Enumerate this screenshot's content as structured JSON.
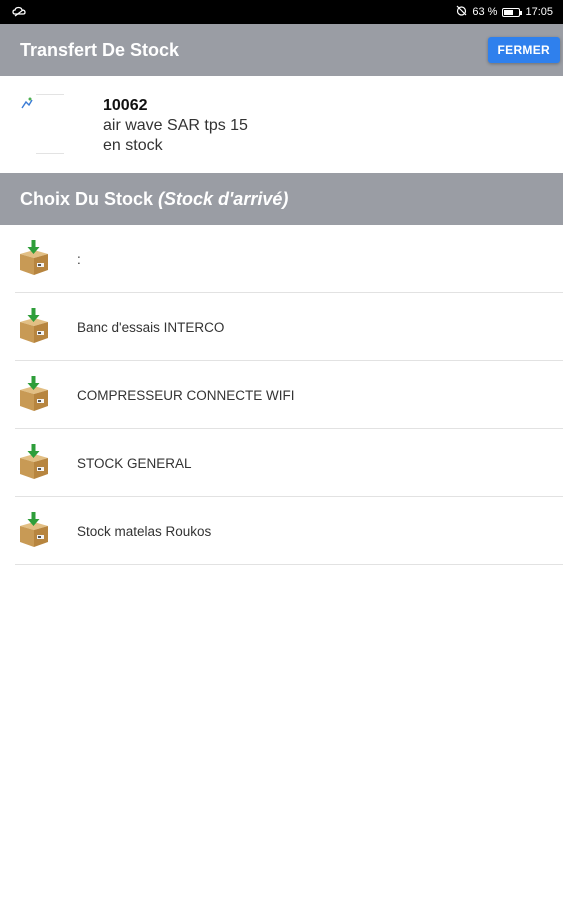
{
  "status_bar": {
    "battery_percent": "63 %",
    "battery_level": 0.63,
    "time": "17:05",
    "left_icon": "cloud-icon",
    "alarm_icon": "alarm-off-icon"
  },
  "app_bar": {
    "title": "Transfert De Stock",
    "close_label": "FERMER",
    "accent_color": "#2f80ed",
    "bar_color": "#9a9da4"
  },
  "product": {
    "reference": "10062",
    "name": "air wave SAR tps 15",
    "status": "en stock",
    "thumbnail_icon": "broken-image-icon"
  },
  "section": {
    "title": "Choix Du Stock",
    "subtitle": "(Stock d'arrivé)"
  },
  "stocks": {
    "icon": "stock-box-icon",
    "items": [
      {
        "label": ":"
      },
      {
        "label": "Banc d'essais INTERCO"
      },
      {
        "label": "COMPRESSEUR CONNECTE WIFI"
      },
      {
        "label": "STOCK GENERAL"
      },
      {
        "label": "Stock matelas Roukos"
      }
    ]
  }
}
